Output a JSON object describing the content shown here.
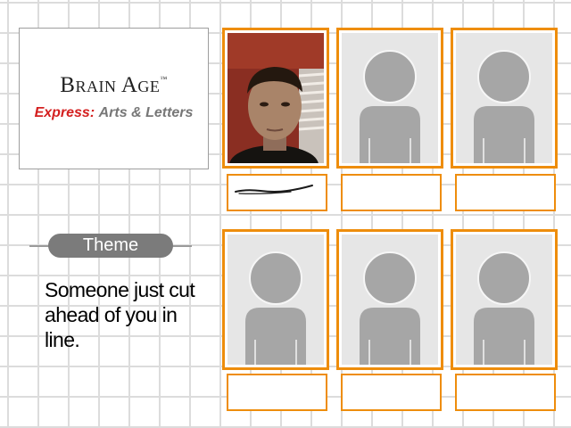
{
  "logo": {
    "title": "Brain Age",
    "trademark": "™",
    "subtitle_brand": "Express:",
    "subtitle_product": "Arts & Letters"
  },
  "theme": {
    "label": "Theme",
    "prompt": "Someone just cut ahead of you in line."
  },
  "cards": [
    {
      "kind": "photo",
      "name_box": "handwritten-scribble"
    },
    {
      "kind": "placeholder",
      "name_box": ""
    },
    {
      "kind": "placeholder",
      "name_box": ""
    },
    {
      "kind": "placeholder",
      "name_box": ""
    },
    {
      "kind": "placeholder",
      "name_box": ""
    },
    {
      "kind": "placeholder",
      "name_box": ""
    }
  ],
  "colors": {
    "card_border": "#ee8d0c",
    "express_red": "#d42020",
    "silhouette": "#a6a6a6",
    "theme_pill": "#7b7b7b"
  },
  "icons": [
    "person-silhouette-icon"
  ]
}
